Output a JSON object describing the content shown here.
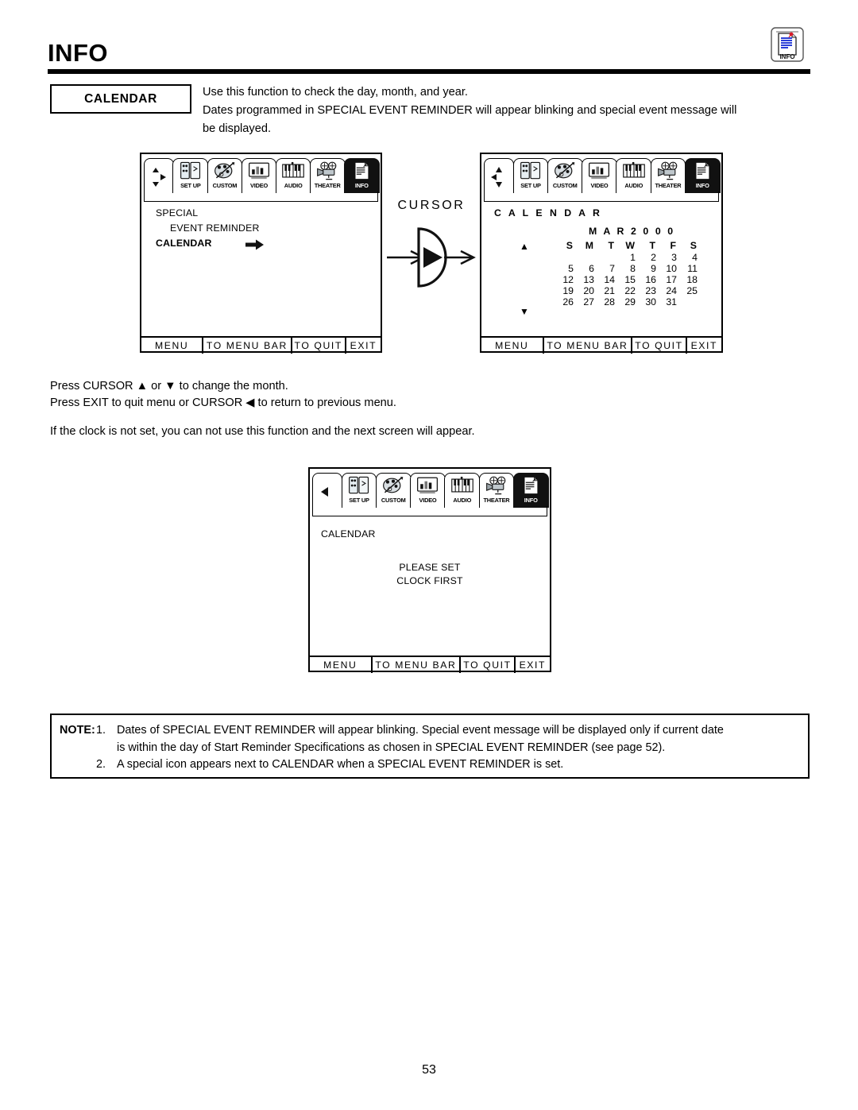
{
  "header": {
    "title": "INFO",
    "icon_name": "info-document-pin-icon",
    "icon_label": "INFO"
  },
  "section": {
    "label": "CALENDAR",
    "intro_lines": [
      "Use this function to check the day, month, and year.",
      "Dates programmed in SPECIAL EVENT REMINDER will appear blinking and special event message will",
      "be displayed."
    ]
  },
  "menu_bar": {
    "items": [
      {
        "label": "SET UP",
        "icon": "outlet-panel-icon",
        "selected": false
      },
      {
        "label": "CUSTOM",
        "icon": "paint-palette-icon",
        "selected": false
      },
      {
        "label": "VIDEO",
        "icon": "bar-chart-screen-icon",
        "selected": false
      },
      {
        "label": "AUDIO",
        "icon": "piano-keyboard-icon",
        "selected": false
      },
      {
        "label": "THEATER",
        "icon": "movie-projector-icon",
        "selected": false
      },
      {
        "label": "INFO",
        "icon": "document-pin-icon",
        "selected": true
      }
    ]
  },
  "status_bar": {
    "cells": [
      "MENU",
      "TO MENU BAR",
      "TO QUIT",
      "EXIT"
    ]
  },
  "screen1": {
    "name": "info-special-menu-screen",
    "pad_icon": "cursor-pad-up-down-right-icon",
    "lines": [
      {
        "text": "SPECIAL",
        "bold": false
      },
      {
        "text": "EVENT REMINDER",
        "bold": false
      },
      {
        "text": "CALENDAR",
        "bold": true
      }
    ],
    "selection_arrow": "arrow-right-icon"
  },
  "cursor_graphic": {
    "label": "CURSOR",
    "button": "cursor-right-button-icon"
  },
  "screen2": {
    "name": "calendar-screen",
    "pad_icon": "cursor-pad-left-up-down-icon",
    "title": "C A L E N D A R",
    "month_year": "M A R   2 0 0 0",
    "up_arrow": "▲",
    "down_arrow": "▼",
    "weekday_headers": [
      "S",
      "M",
      "T",
      "W",
      "T",
      "F",
      "S"
    ],
    "weeks": [
      [
        "",
        "",
        "",
        "1",
        "2",
        "3",
        "4"
      ],
      [
        "5",
        "6",
        "7",
        "8",
        "9",
        "10",
        "11"
      ],
      [
        "12",
        "13",
        "14",
        "15",
        "16",
        "17",
        "18"
      ],
      [
        "19",
        "20",
        "21",
        "22",
        "23",
        "24",
        "25"
      ],
      [
        "26",
        "27",
        "28",
        "29",
        "30",
        "31",
        ""
      ]
    ]
  },
  "instructions": {
    "line1": "Press CURSOR ▲ or ▼ to change the month.",
    "line2": "Press EXIT to quit menu or CURSOR ◀ to return to previous menu.",
    "line3": "If the clock is not set, you can not use this function and the next screen will appear."
  },
  "screen3": {
    "name": "please-set-clock-screen",
    "pad_icon": "cursor-pad-left-icon",
    "title": "CALENDAR",
    "message_line1": "PLEASE SET",
    "message_line2": "CLOCK FIRST"
  },
  "note": {
    "label": "NOTE:",
    "items": [
      {
        "num": "1.",
        "line1": "Dates of SPECIAL EVENT REMINDER will appear blinking.  Special event message will be displayed only if current date",
        "line2": "is within the day of Start Reminder Specifications as chosen in SPECIAL EVENT REMINDER (see page 52)."
      },
      {
        "num": "2.",
        "line1": "A special icon appears next to  CALENDAR  when a SPECIAL EVENT REMINDER is set.",
        "line2": ""
      }
    ]
  },
  "page_number": "53"
}
